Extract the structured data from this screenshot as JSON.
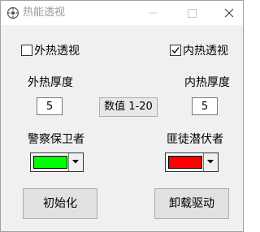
{
  "window": {
    "title": "热能透视"
  },
  "checkboxes": {
    "outer": {
      "label": "外热透视",
      "checked": false
    },
    "inner": {
      "label": "内热透视",
      "checked": true
    }
  },
  "thickness": {
    "outer_label": "外热厚度",
    "outer_value": "5",
    "inner_label": "内热厚度",
    "inner_value": "5",
    "range_label": "数值 1-20"
  },
  "colors": {
    "police_label": "警察保卫者",
    "police_color": "#00ff00",
    "bandit_label": "匪徒潜伏者",
    "bandit_color": "#ff0000"
  },
  "buttons": {
    "init_label": "初始化",
    "unload_label": "卸载驱动"
  }
}
